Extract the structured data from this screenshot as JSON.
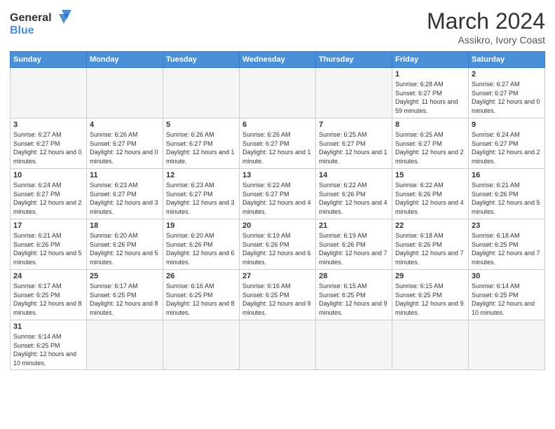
{
  "header": {
    "logo": {
      "general": "General",
      "blue": "Blue"
    },
    "title": "March 2024",
    "subtitle": "Assikro, Ivory Coast"
  },
  "weekdays": [
    "Sunday",
    "Monday",
    "Tuesday",
    "Wednesday",
    "Thursday",
    "Friday",
    "Saturday"
  ],
  "weeks": [
    [
      {
        "day": "",
        "info": ""
      },
      {
        "day": "",
        "info": ""
      },
      {
        "day": "",
        "info": ""
      },
      {
        "day": "",
        "info": ""
      },
      {
        "day": "",
        "info": ""
      },
      {
        "day": "1",
        "info": "Sunrise: 6:28 AM\nSunset: 6:27 PM\nDaylight: 11 hours\nand 59 minutes."
      },
      {
        "day": "2",
        "info": "Sunrise: 6:27 AM\nSunset: 6:27 PM\nDaylight: 12 hours\nand 0 minutes."
      }
    ],
    [
      {
        "day": "3",
        "info": "Sunrise: 6:27 AM\nSunset: 6:27 PM\nDaylight: 12 hours\nand 0 minutes."
      },
      {
        "day": "4",
        "info": "Sunrise: 6:26 AM\nSunset: 6:27 PM\nDaylight: 12 hours\nand 0 minutes."
      },
      {
        "day": "5",
        "info": "Sunrise: 6:26 AM\nSunset: 6:27 PM\nDaylight: 12 hours\nand 1 minute."
      },
      {
        "day": "6",
        "info": "Sunrise: 6:26 AM\nSunset: 6:27 PM\nDaylight: 12 hours\nand 1 minute."
      },
      {
        "day": "7",
        "info": "Sunrise: 6:25 AM\nSunset: 6:27 PM\nDaylight: 12 hours\nand 1 minute."
      },
      {
        "day": "8",
        "info": "Sunrise: 6:25 AM\nSunset: 6:27 PM\nDaylight: 12 hours\nand 2 minutes."
      },
      {
        "day": "9",
        "info": "Sunrise: 6:24 AM\nSunset: 6:27 PM\nDaylight: 12 hours\nand 2 minutes."
      }
    ],
    [
      {
        "day": "10",
        "info": "Sunrise: 6:24 AM\nSunset: 6:27 PM\nDaylight: 12 hours\nand 2 minutes."
      },
      {
        "day": "11",
        "info": "Sunrise: 6:23 AM\nSunset: 6:27 PM\nDaylight: 12 hours\nand 3 minutes."
      },
      {
        "day": "12",
        "info": "Sunrise: 6:23 AM\nSunset: 6:27 PM\nDaylight: 12 hours\nand 3 minutes."
      },
      {
        "day": "13",
        "info": "Sunrise: 6:22 AM\nSunset: 6:27 PM\nDaylight: 12 hours\nand 4 minutes."
      },
      {
        "day": "14",
        "info": "Sunrise: 6:22 AM\nSunset: 6:26 PM\nDaylight: 12 hours\nand 4 minutes."
      },
      {
        "day": "15",
        "info": "Sunrise: 6:22 AM\nSunset: 6:26 PM\nDaylight: 12 hours\nand 4 minutes."
      },
      {
        "day": "16",
        "info": "Sunrise: 6:21 AM\nSunset: 6:26 PM\nDaylight: 12 hours\nand 5 minutes."
      }
    ],
    [
      {
        "day": "17",
        "info": "Sunrise: 6:21 AM\nSunset: 6:26 PM\nDaylight: 12 hours\nand 5 minutes."
      },
      {
        "day": "18",
        "info": "Sunrise: 6:20 AM\nSunset: 6:26 PM\nDaylight: 12 hours\nand 5 minutes."
      },
      {
        "day": "19",
        "info": "Sunrise: 6:20 AM\nSunset: 6:26 PM\nDaylight: 12 hours\nand 6 minutes."
      },
      {
        "day": "20",
        "info": "Sunrise: 6:19 AM\nSunset: 6:26 PM\nDaylight: 12 hours\nand 6 minutes."
      },
      {
        "day": "21",
        "info": "Sunrise: 6:19 AM\nSunset: 6:26 PM\nDaylight: 12 hours\nand 7 minutes."
      },
      {
        "day": "22",
        "info": "Sunrise: 6:18 AM\nSunset: 6:26 PM\nDaylight: 12 hours\nand 7 minutes."
      },
      {
        "day": "23",
        "info": "Sunrise: 6:18 AM\nSunset: 6:25 PM\nDaylight: 12 hours\nand 7 minutes."
      }
    ],
    [
      {
        "day": "24",
        "info": "Sunrise: 6:17 AM\nSunset: 6:25 PM\nDaylight: 12 hours\nand 8 minutes."
      },
      {
        "day": "25",
        "info": "Sunrise: 6:17 AM\nSunset: 6:25 PM\nDaylight: 12 hours\nand 8 minutes."
      },
      {
        "day": "26",
        "info": "Sunrise: 6:16 AM\nSunset: 6:25 PM\nDaylight: 12 hours\nand 8 minutes."
      },
      {
        "day": "27",
        "info": "Sunrise: 6:16 AM\nSunset: 6:25 PM\nDaylight: 12 hours\nand 9 minutes."
      },
      {
        "day": "28",
        "info": "Sunrise: 6:15 AM\nSunset: 6:25 PM\nDaylight: 12 hours\nand 9 minutes."
      },
      {
        "day": "29",
        "info": "Sunrise: 6:15 AM\nSunset: 6:25 PM\nDaylight: 12 hours\nand 9 minutes."
      },
      {
        "day": "30",
        "info": "Sunrise: 6:14 AM\nSunset: 6:25 PM\nDaylight: 12 hours\nand 10 minutes."
      }
    ],
    [
      {
        "day": "31",
        "info": "Sunrise: 6:14 AM\nSunset: 6:25 PM\nDaylight: 12 hours\nand 10 minutes."
      },
      {
        "day": "",
        "info": ""
      },
      {
        "day": "",
        "info": ""
      },
      {
        "day": "",
        "info": ""
      },
      {
        "day": "",
        "info": ""
      },
      {
        "day": "",
        "info": ""
      },
      {
        "day": "",
        "info": ""
      }
    ]
  ]
}
